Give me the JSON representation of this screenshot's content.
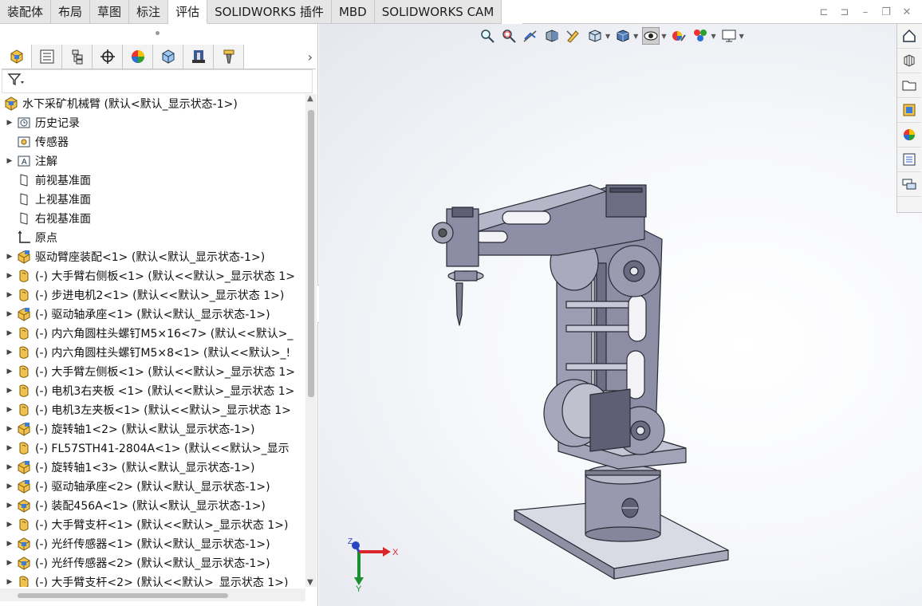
{
  "tabs": [
    "装配体",
    "布局",
    "草图",
    "标注",
    "评估",
    "SOLIDWORKS 插件",
    "MBD",
    "SOLIDWORKS CAM"
  ],
  "active_tab_index": 4,
  "window_controls": [
    "restore-left-icon",
    "restore-right-icon",
    "minimize-icon",
    "maximize-icon",
    "close-icon"
  ],
  "panel_tabs": [
    "feature-manager-icon",
    "property-manager-icon",
    "configuration-manager-icon",
    "dimxpert-icon",
    "display-manager-icon",
    "cam-feature-icon",
    "cam-operation-icon",
    "cam-tool-icon"
  ],
  "tree": {
    "root": "水下采矿机械臂  (默认<默认_显示状态-1>)",
    "items": [
      {
        "label": "历史记录",
        "icon": "history-icon",
        "expand": true
      },
      {
        "label": "传感器",
        "icon": "sensor-icon",
        "expand": false
      },
      {
        "label": "注解",
        "icon": "annotation-icon",
        "expand": true
      },
      {
        "label": "前视基准面",
        "icon": "plane-icon",
        "expand": false
      },
      {
        "label": "上视基准面",
        "icon": "plane-icon",
        "expand": false
      },
      {
        "label": "右视基准面",
        "icon": "plane-icon",
        "expand": false
      },
      {
        "label": "原点",
        "icon": "origin-icon",
        "expand": false
      },
      {
        "label": "驱动臂座装配<1> (默认<默认_显示状态-1>)",
        "icon": "subassembly-icon",
        "expand": true
      },
      {
        "label": "(-) 大手臂右侧板<1> (默认<<默认>_显示状态 1>",
        "icon": "part-icon",
        "expand": true
      },
      {
        "label": "(-) 步进电机2<1> (默认<<默认>_显示状态 1>)",
        "icon": "part-icon",
        "expand": true
      },
      {
        "label": "(-) 驱动轴承座<1> (默认<默认_显示状态-1>)",
        "icon": "subassembly-icon",
        "expand": true
      },
      {
        "label": "(-) 内六角圆柱头螺钉M5×16<7> (默认<<默认>_",
        "icon": "part-icon",
        "expand": true
      },
      {
        "label": "(-) 内六角圆柱头螺钉M5×8<1> (默认<<默认>_!",
        "icon": "part-icon",
        "expand": true
      },
      {
        "label": "(-) 大手臂左侧板<1> (默认<<默认>_显示状态 1>",
        "icon": "part-icon",
        "expand": true
      },
      {
        "label": "(-) 电机3右夹板 <1> (默认<<默认>_显示状态 1>",
        "icon": "part-icon",
        "expand": true
      },
      {
        "label": "(-) 电机3左夹板<1> (默认<<默认>_显示状态 1>",
        "icon": "part-icon",
        "expand": true
      },
      {
        "label": "(-) 旋转轴1<2> (默认<默认_显示状态-1>)",
        "icon": "subassembly-icon",
        "expand": true
      },
      {
        "label": "(-) FL57STH41-2804A<1> (默认<<默认>_显示",
        "icon": "part-icon",
        "expand": true
      },
      {
        "label": "(-) 旋转轴1<3> (默认<默认_显示状态-1>)",
        "icon": "subassembly-icon",
        "expand": true
      },
      {
        "label": "(-) 驱动轴承座<2> (默认<默认_显示状态-1>)",
        "icon": "subassembly-icon",
        "expand": true
      },
      {
        "label": "(-) 装配456A<1> (默认<默认_显示状态-1>)",
        "icon": "assembly-icon",
        "expand": true
      },
      {
        "label": "(-) 大手臂支杆<1> (默认<<默认>_显示状态 1>)",
        "icon": "part-icon",
        "expand": true
      },
      {
        "label": "(-) 光纤传感器<1> (默认<默认_显示状态-1>)",
        "icon": "assembly-icon",
        "expand": true
      },
      {
        "label": "(-) 光纤传感器<2> (默认<默认_显示状态-1>)",
        "icon": "assembly-icon",
        "expand": true
      },
      {
        "label": "(-) 大手臂支杆<2> (默认<<默认>_显示状态 1>)",
        "icon": "part-icon",
        "expand": true
      }
    ]
  },
  "heads_up_toolbar": [
    "zoom-to-fit-icon",
    "zoom-to-area-icon",
    "previous-view-icon",
    "section-view-icon",
    "dynamic-annotation-icon",
    "view-orientation-icon",
    "display-style-icon",
    "hide-show-icon",
    "edit-appearance-icon",
    "apply-scene-icon",
    "view-settings-icon"
  ],
  "task_pane": [
    "home-icon",
    "3d-content-icon",
    "file-explorer-icon",
    "view-palette-icon",
    "appearances-icon",
    "custom-properties-icon",
    "forum-icon"
  ],
  "triad": {
    "x": "X",
    "y": "Y",
    "z": "Z"
  },
  "colors": {
    "part_body": "#8e8fa6",
    "tab_bg": "#e6e6e6",
    "triad_x": "#d9262b",
    "triad_y": "#1a8f2e",
    "triad_z": "#2a45c4"
  }
}
